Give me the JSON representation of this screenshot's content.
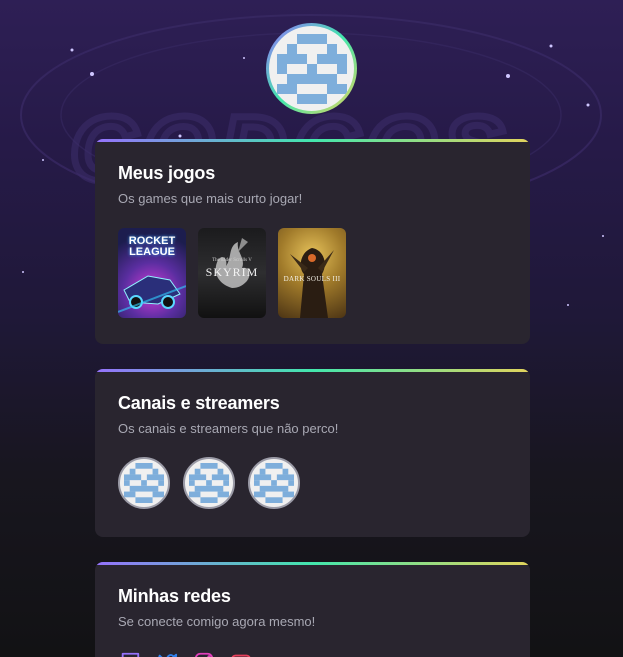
{
  "profile": {
    "avatar_icon": "identicon-avatar-icon"
  },
  "games_section": {
    "title": "Meus jogos",
    "subtitle": "Os games que mais curto jogar!",
    "games": [
      {
        "name": "Rocket League",
        "cover_text": "ROCKET LEAGUE",
        "icon": "rocket-league-cover"
      },
      {
        "name": "Skyrim",
        "cover_top": "The Elder Scrolls V",
        "cover_text": "SKYRIM",
        "icon": "skyrim-cover"
      },
      {
        "name": "Dark Souls III",
        "cover_text": "DARK SOULS III",
        "icon": "dark-souls-cover"
      }
    ]
  },
  "streamers_section": {
    "title": "Canais e streamers",
    "subtitle": "Os canais e streamers que não perco!",
    "streamers": [
      {
        "icon": "identicon-avatar-icon"
      },
      {
        "icon": "identicon-avatar-icon"
      },
      {
        "icon": "identicon-avatar-icon"
      }
    ]
  },
  "social_section": {
    "title": "Minhas redes",
    "subtitle": "Se conecte comigo agora mesmo!",
    "links": [
      {
        "icon": "twitch-icon",
        "color": "#9572fc"
      },
      {
        "icon": "twitter-icon",
        "color": "#2f80ed"
      },
      {
        "icon": "instagram-icon",
        "color": "#e13fbb"
      },
      {
        "icon": "youtube-icon",
        "color": "#e83f5b"
      }
    ]
  },
  "colors": {
    "accent_purple": "#9572fc",
    "accent_green": "#43e7ad",
    "accent_yellow": "#e2d45c",
    "card_bg": "#29252f",
    "identicon_blue": "#7eaedb"
  }
}
